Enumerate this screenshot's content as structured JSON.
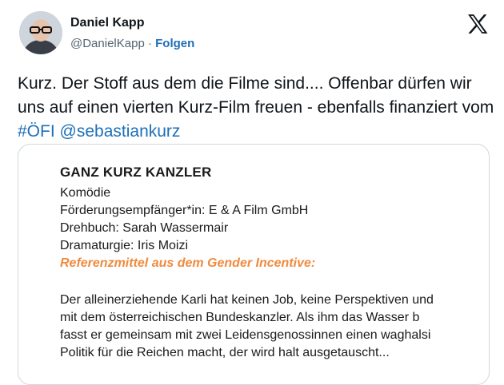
{
  "author": {
    "name": "Daniel Kapp",
    "handle": "@DanielKapp",
    "separator": "·",
    "follow_label": "Folgen"
  },
  "tweet": {
    "text_plain": "Kurz. Der Stoff aus dem die Filme sind.... Offenbar dürfen wir uns auf einen vierten Kurz-Film freuen - ebenfalls finanziert vom ",
    "hashtag": "#ÖFI",
    "space": " ",
    "mention": "@sebastiankurz"
  },
  "document": {
    "title": "GANZ KURZ KANZLER",
    "genre": "Komödie",
    "recipient": "Förderungsempfänger*in: E & A Film GmbH",
    "script": "Drehbuch: Sarah Wassermair",
    "dramaturgy": "Dramaturgie: Iris Moizi",
    "reference": "Referenzmittel aus dem Gender Incentive:",
    "desc_lines": [
      "Der alleinerziehende Karli hat keinen Job, keine Perspektiven und",
      "mit dem österreichischen Bundeskanzler. Als ihm das Wasser b",
      "fasst er gemeinsam mit zwei Leidensgenossinnen einen waghalsi",
      "Politik für die Reichen macht, der wird halt ausgetauscht..."
    ]
  },
  "icons": {
    "avatar": "profile-photo",
    "logo": "x-logo-icon"
  },
  "colors": {
    "link": "#1d6fb8",
    "highlight": "#f08a3e",
    "secondary_text": "#536471"
  }
}
